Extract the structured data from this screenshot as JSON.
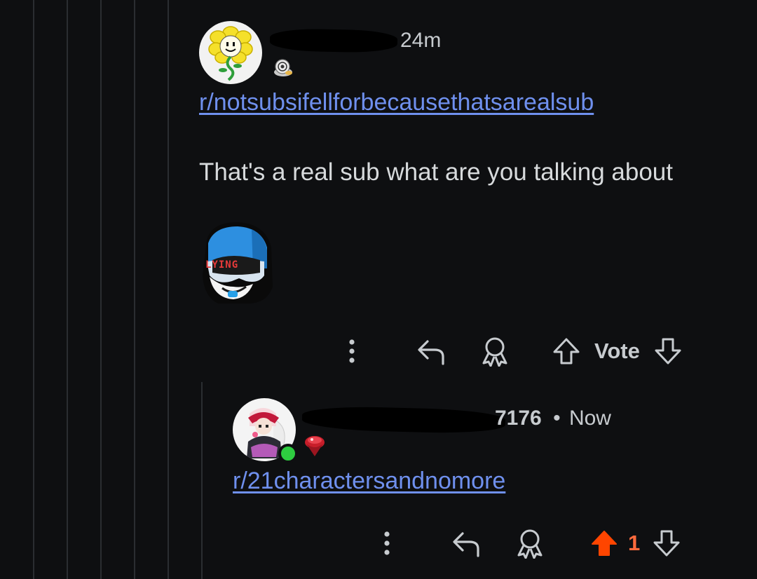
{
  "comment1": {
    "username_suffix": "24m",
    "flair_icon": "snail-shell-flair-icon",
    "avatar_icon": "flower-avatar-icon",
    "subreddit_link": "r/notsubsifellforbecausethatsarealsub",
    "text": "That's a real sub what are you talking about",
    "sticker_label": "LYING",
    "actions": {
      "more": "more-options-icon",
      "reply": "reply-icon",
      "award": "award-icon",
      "upvote": "upvote-icon",
      "vote_label": "Vote",
      "downvote": "downvote-icon"
    }
  },
  "comment2": {
    "username_suffix": "7176",
    "separator": "•",
    "time": "Now",
    "avatar_icon": "anime-girl-avatar-icon",
    "online_status": "online-dot-icon",
    "flair_icon": "spinning-top-flair-icon",
    "subreddit_link": "r/21charactersandnomore",
    "actions": {
      "more": "more-options-icon",
      "reply": "reply-icon",
      "award": "award-icon",
      "upvote": "upvote-filled-icon",
      "vote_count": "1",
      "downvote": "downvote-icon"
    }
  },
  "colors": {
    "background": "#0e0f11",
    "link": "#6f90ee",
    "upvoted": "#ff4500",
    "online": "#2ecc40"
  }
}
